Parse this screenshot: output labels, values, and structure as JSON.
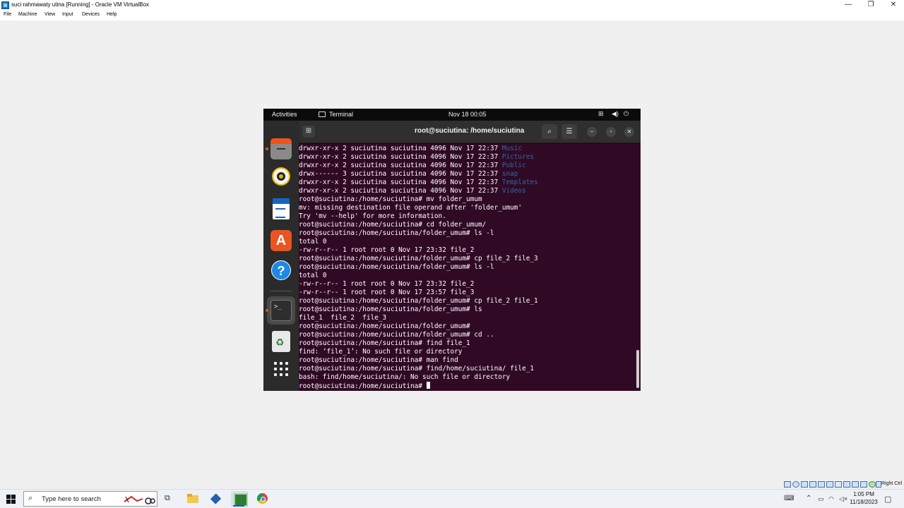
{
  "host_window": {
    "title": "suci rahmawaty utina [Running] - Oracle VM VirtualBox",
    "minimize_glyph": "—",
    "maximize_glyph": "❐",
    "close_glyph": "✕",
    "menu": [
      "File",
      "Machine",
      "View",
      "Input",
      "Devices",
      "Help"
    ]
  },
  "gnome": {
    "activities": "Activities",
    "app_name": "Terminal",
    "clock": "Nov 18  00:05",
    "tray_icons": [
      "network-icon",
      "volume-icon",
      "power-icon"
    ]
  },
  "dock": {
    "items": [
      "files",
      "rhythmbox",
      "libreoffice-writer",
      "ubuntu-software",
      "help",
      "terminal",
      "trash",
      "show-applications"
    ],
    "running": [
      "files",
      "terminal"
    ],
    "terminal_glyph": ">_",
    "software_glyph": "A",
    "help_glyph": "?"
  },
  "terminal": {
    "title": "root@suciutina: /home/suciutina",
    "lines": [
      {
        "text": "drwxr-xr-x 2 suciutina suciutina 4096 Nov 17 22:37 ",
        "dir": "Music"
      },
      {
        "text": "drwxr-xr-x 2 suciutina suciutina 4096 Nov 17 22:37 ",
        "dir": "Pictures"
      },
      {
        "text": "drwxr-xr-x 2 suciutina suciutina 4096 Nov 17 22:37 ",
        "dir": "Public"
      },
      {
        "text": "drwx------ 3 suciutina suciutina 4096 Nov 17 22:37 ",
        "dir": "snap"
      },
      {
        "text": "drwxr-xr-x 2 suciutina suciutina 4096 Nov 17 22:37 ",
        "dir": "Templates"
      },
      {
        "text": "drwxr-xr-x 2 suciutina suciutina 4096 Nov 17 22:37 ",
        "dir": "Videos"
      },
      {
        "text": "root@suciutina:/home/suciutina# mv folder_umum"
      },
      {
        "text": "mv: missing destination file operand after 'folder_umum'"
      },
      {
        "text": "Try 'mv --help' for more information."
      },
      {
        "text": "root@suciutina:/home/suciutina# cd folder_umum/"
      },
      {
        "text": "root@suciutina:/home/suciutina/folder_umum# ls -l"
      },
      {
        "text": "total 0"
      },
      {
        "text": "-rw-r--r-- 1 root root 0 Nov 17 23:32 file_2"
      },
      {
        "text": "root@suciutina:/home/suciutina/folder_umum# cp file_2 file_3"
      },
      {
        "text": "root@suciutina:/home/suciutina/folder_umum# ls -l"
      },
      {
        "text": "total 0"
      },
      {
        "text": "-rw-r--r-- 1 root root 0 Nov 17 23:32 file_2"
      },
      {
        "text": "-rw-r--r-- 1 root root 0 Nov 17 23:57 file_3"
      },
      {
        "text": "root@suciutina:/home/suciutina/folder_umum# cp file_2 file_1"
      },
      {
        "text": "root@suciutina:/home/suciutina/folder_umum# ls"
      },
      {
        "text": "file_1  file_2  file_3"
      },
      {
        "text": "root@suciutina:/home/suciutina/folder_umum#"
      },
      {
        "text": "root@suciutina:/home/suciutina/folder_umum# cd .."
      },
      {
        "text": "root@suciutina:/home/suciutina# find file_1"
      },
      {
        "text": "find: ‘file_1’: No such file or directory"
      },
      {
        "text": "root@suciutina:/home/suciutina# man find"
      },
      {
        "text": "root@suciutina:/home/suciutina# find/home/suciutina/ file_1"
      },
      {
        "text": "bash: find/home/suciutina/: No such file or directory"
      },
      {
        "text": "root@suciutina:/home/suciutina# ",
        "cursor": true
      }
    ],
    "colors": {
      "background": "#300a24",
      "text": "#ffffff",
      "directory": "#3465a4"
    }
  },
  "taskbar": {
    "search_placeholder": "Type here to search",
    "apps": [
      "file-explorer",
      "virtualbox-manager",
      "virtualbox-vm",
      "chrome"
    ],
    "active_app": "virtualbox-vm",
    "host_key": "Right Ctrl",
    "time": "1:05 PM",
    "date": "11/18/2023"
  }
}
